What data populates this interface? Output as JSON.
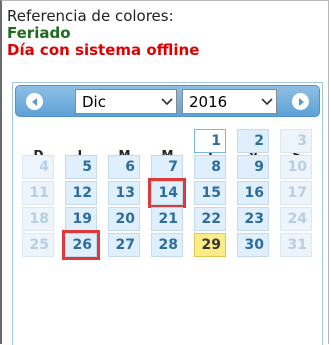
{
  "legend": {
    "title": "Referencia de colores:",
    "holiday": "Feriado",
    "offline": "Día con sistema offline"
  },
  "calendar": {
    "month": "Dic",
    "year": "2016",
    "weekdays": [
      "D",
      "L",
      "M",
      "M",
      "J",
      "V",
      "S"
    ],
    "weeks": [
      [
        null,
        null,
        null,
        null,
        {
          "d": "1",
          "s": "today"
        },
        {
          "d": "2",
          "s": "normal"
        },
        {
          "d": "3",
          "s": "dim"
        }
      ],
      [
        {
          "d": "4",
          "s": "dim"
        },
        {
          "d": "5",
          "s": "normal"
        },
        {
          "d": "6",
          "s": "normal"
        },
        {
          "d": "7",
          "s": "normal"
        },
        {
          "d": "8",
          "s": "normal"
        },
        {
          "d": "9",
          "s": "normal"
        },
        {
          "d": "10",
          "s": "dim"
        }
      ],
      [
        {
          "d": "11",
          "s": "dim"
        },
        {
          "d": "12",
          "s": "normal"
        },
        {
          "d": "13",
          "s": "normal"
        },
        {
          "d": "14",
          "s": "offline"
        },
        {
          "d": "15",
          "s": "normal"
        },
        {
          "d": "16",
          "s": "normal"
        },
        {
          "d": "17",
          "s": "dim"
        }
      ],
      [
        {
          "d": "18",
          "s": "dim"
        },
        {
          "d": "19",
          "s": "normal"
        },
        {
          "d": "20",
          "s": "normal"
        },
        {
          "d": "21",
          "s": "normal"
        },
        {
          "d": "22",
          "s": "normal"
        },
        {
          "d": "23",
          "s": "normal"
        },
        {
          "d": "24",
          "s": "dim"
        }
      ],
      [
        {
          "d": "25",
          "s": "dim"
        },
        {
          "d": "26",
          "s": "offline"
        },
        {
          "d": "27",
          "s": "normal"
        },
        {
          "d": "28",
          "s": "normal"
        },
        {
          "d": "29",
          "s": "highlight"
        },
        {
          "d": "30",
          "s": "normal"
        },
        {
          "d": "31",
          "s": "dim"
        }
      ]
    ]
  },
  "icons": {
    "prev": "circle-triangle-left-icon",
    "next": "circle-triangle-right-icon",
    "dropdown": "chevron-down-icon"
  },
  "colors": {
    "holiday": "#1e6b1e",
    "offline": "#e00000",
    "offline_marker": "#dd3b3b",
    "header_blue": "#5ea2d6",
    "day_text": "#2e6e9e",
    "highlight_day": "#fbec88"
  }
}
